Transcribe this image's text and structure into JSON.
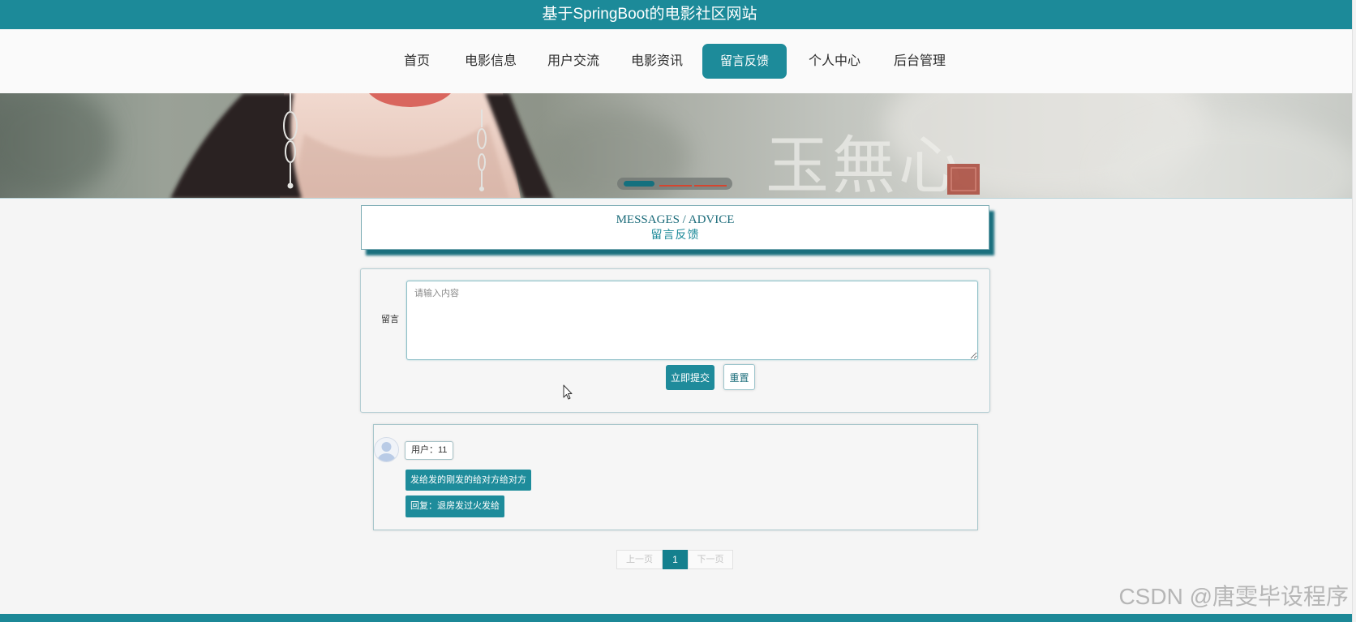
{
  "site": {
    "title": "基于SpringBoot的电影社区网站"
  },
  "nav": {
    "items": [
      {
        "label": "首页",
        "active": false
      },
      {
        "label": "电影信息",
        "active": false
      },
      {
        "label": "用户交流",
        "active": false
      },
      {
        "label": "电影资讯",
        "active": false
      },
      {
        "label": "留言反馈",
        "active": true
      },
      {
        "label": "个人中心",
        "active": false
      },
      {
        "label": "后台管理",
        "active": false
      }
    ]
  },
  "banner": {
    "calligraphy": "玉無心",
    "slide_count": 3,
    "active_slide": 1
  },
  "section": {
    "title_en": "MESSAGES / ADVICE",
    "title_cn": "留言反馈"
  },
  "form": {
    "label": "留言",
    "placeholder": "请输入内容",
    "value": "",
    "submit_label": "立即提交",
    "reset_label": "重置"
  },
  "messages": [
    {
      "avatar_icon": "default-user-icon",
      "user": "用户：11",
      "content": "发给发的刚发的给对方给对方",
      "reply": "回复：退房发过火发给"
    }
  ],
  "pagination": {
    "prev_label": "上一页",
    "current_page": "1",
    "next_label": "下一页"
  },
  "watermark": "CSDN @唐雯毕设程序",
  "colors": {
    "primary": "#1c8a99",
    "active_nav": "#1d8b9a",
    "page_background": "#f5f5f5",
    "indicator_active": "#14707e",
    "indicator_inactive": "#d5452f"
  }
}
